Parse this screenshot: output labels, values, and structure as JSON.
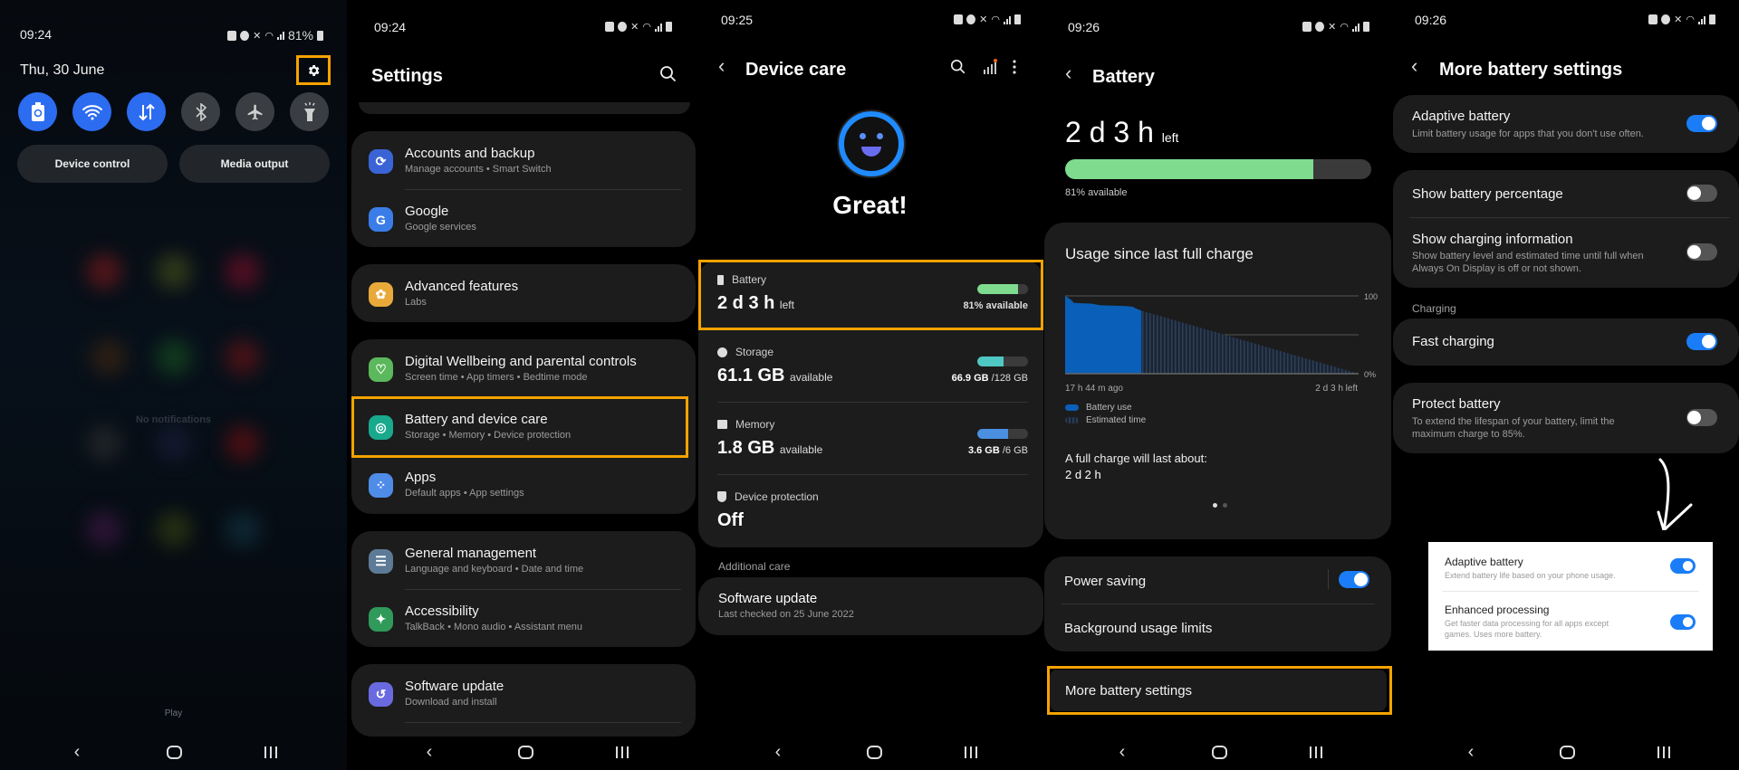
{
  "panel1": {
    "status_time": "09:24",
    "battery_pct": "81%",
    "date": "Thu, 30 June",
    "settings_icon": "gear-icon",
    "quick_tiles": [
      {
        "name": "power-saving",
        "icon": "battery-recycle-icon",
        "state": "on"
      },
      {
        "name": "wifi",
        "icon": "wifi-icon",
        "state": "on"
      },
      {
        "name": "mobile-data",
        "icon": "data-arrows-icon",
        "state": "on"
      },
      {
        "name": "bluetooth",
        "icon": "bluetooth-icon",
        "state": "off"
      },
      {
        "name": "airplane-mode",
        "icon": "airplane-icon",
        "state": "off"
      },
      {
        "name": "flashlight",
        "icon": "flashlight-icon",
        "state": "off"
      }
    ],
    "device_control": "Device control",
    "media_output": "Media output",
    "no_notifications": "No notifications",
    "play": "Play"
  },
  "panel2": {
    "status_time": "09:24",
    "title": "Settings",
    "groups": [
      [
        {
          "title": "Accounts and backup",
          "subtitle": "Manage accounts  •  Smart Switch",
          "icon_color": "#3a64d6",
          "icon": "sync-icon"
        },
        {
          "title": "Google",
          "subtitle": "Google services",
          "icon_color": "#3b7de8",
          "icon": "google-icon"
        }
      ],
      [
        {
          "title": "Advanced features",
          "subtitle": "Labs",
          "icon_color": "#e9a93a",
          "icon": "gear-plus-icon"
        }
      ],
      [
        {
          "title": "Digital Wellbeing and parental controls",
          "subtitle": "Screen time  •  App timers  •  Bedtime mode",
          "icon_color": "#5cb85c",
          "icon": "heart-circle-icon"
        },
        {
          "title": "Battery and device care",
          "subtitle": "Storage  •  Memory  •  Device protection",
          "icon_color": "#19a98c",
          "icon": "device-care-icon"
        },
        {
          "title": "Apps",
          "subtitle": "Default apps  •  App settings",
          "icon_color": "#4f8ce8",
          "icon": "apps-grid-icon"
        }
      ],
      [
        {
          "title": "General management",
          "subtitle": "Language and keyboard  •  Date and time",
          "icon_color": "#5d7a96",
          "icon": "sliders-icon"
        },
        {
          "title": "Accessibility",
          "subtitle": "TalkBack  •  Mono audio  •  Assistant menu",
          "icon_color": "#2f9a5a",
          "icon": "accessibility-icon"
        }
      ],
      [
        {
          "title": "Software update",
          "subtitle": "Download and install",
          "icon_color": "#6a6ae0",
          "icon": "update-icon"
        }
      ]
    ]
  },
  "panel3": {
    "status_time": "09:25",
    "title": "Device care",
    "status": "Great!",
    "battery": {
      "label": "Battery",
      "value": "2 d 3 h",
      "suffix": "left",
      "caption": "81% available",
      "fill": 0.81,
      "color": "#7fdc8f"
    },
    "storage": {
      "label": "Storage",
      "value": "61.1 GB",
      "suffix": "available",
      "used": "66.9 GB",
      "total": "/128 GB",
      "fill": 0.52,
      "color": "#4fc7c2"
    },
    "memory": {
      "label": "Memory",
      "value": "1.8 GB",
      "suffix": "available",
      "used": "3.6 GB",
      "total": "/6 GB",
      "fill": 0.6,
      "color": "#4a8fe0"
    },
    "protection": {
      "label": "Device protection",
      "value": "Off"
    },
    "additional_care": "Additional care",
    "software_update": {
      "title": "Software update",
      "subtitle": "Last checked on 25 June 2022"
    }
  },
  "panel4": {
    "status_time": "09:26",
    "title": "Battery",
    "time_left": "2 d 3 h",
    "time_left_suffix": "left",
    "battery_fill": 0.81,
    "available": "81% available",
    "usage_title": "Usage since last full charge",
    "chart_left_label": "17 h 44 m ago",
    "chart_right_label": "2 d 3 h left",
    "legend_use": "Battery use",
    "legend_est": "Estimated time",
    "full_charge_label": "A full charge will last about:",
    "full_charge_value": "2 d 2 h",
    "power_saving": "Power saving",
    "power_saving_on": true,
    "background_limits": "Background usage limits",
    "more_settings": "More battery settings"
  },
  "chart_data": {
    "type": "area",
    "title": "Usage since last full charge",
    "xlabel": "",
    "ylabel": "",
    "y_ticks": [
      "100",
      "0%"
    ],
    "ylim": [
      0,
      100
    ],
    "x_labels": [
      "17 h 44 m ago",
      "2 d 3 h left"
    ],
    "series": [
      {
        "name": "Battery use",
        "x": [
          0,
          0.02,
          0.03,
          0.09,
          0.12,
          0.2,
          0.23,
          0.24,
          0.26
        ],
        "values": [
          100,
          95,
          91,
          90,
          88,
          87,
          86,
          84,
          81
        ]
      },
      {
        "name": "Estimated time",
        "x": [
          0.26,
          1.0
        ],
        "values": [
          81,
          0
        ]
      }
    ],
    "grid": true
  },
  "panel5": {
    "status_time": "09:26",
    "title": "More battery settings",
    "adaptive": {
      "title": "Adaptive battery",
      "subtitle": "Limit battery usage for apps that you don't use often.",
      "on": true
    },
    "show_pct": {
      "title": "Show battery percentage",
      "on": false
    },
    "show_charging": {
      "title": "Show charging information",
      "subtitle": "Show battery level and estimated time until full when Always On Display is off or not shown.",
      "on": false
    },
    "charging_label": "Charging",
    "fast_charging": {
      "title": "Fast charging",
      "on": true
    },
    "protect": {
      "title": "Protect battery",
      "subtitle": "To extend the lifespan of your battery, limit the maximum charge to 85%.",
      "on": false
    },
    "inset": [
      {
        "title": "Adaptive battery",
        "subtitle": "Extend battery life based on your phone usage.",
        "on": true
      },
      {
        "title": "Enhanced processing",
        "subtitle": "Get faster data processing for all apps except games. Uses more battery.",
        "on": true
      }
    ]
  }
}
